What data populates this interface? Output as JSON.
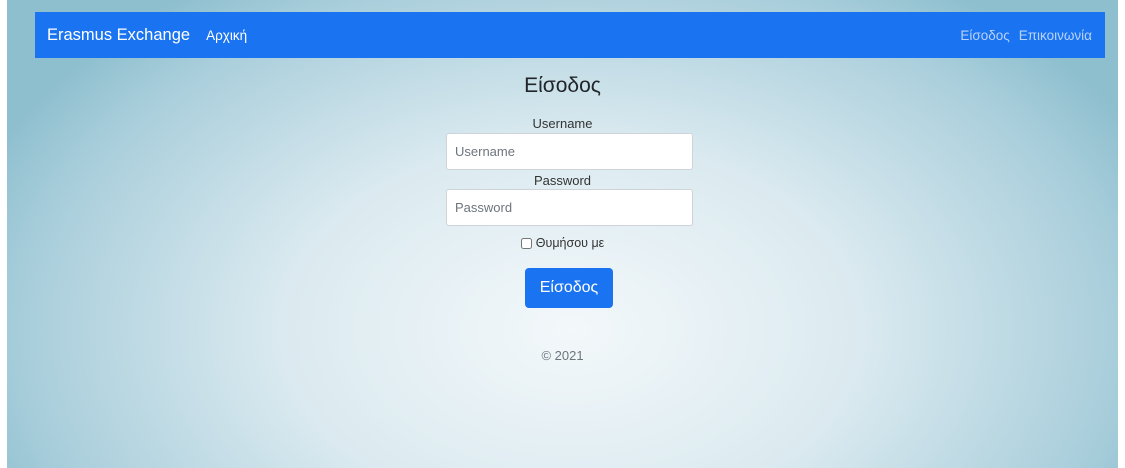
{
  "navbar": {
    "brand": "Erasmus Exchange",
    "home_link": "Αρχική",
    "login_link": "Είσοδος",
    "contact_link": "Επικοινωνία",
    "bg_color": "#1a73f0"
  },
  "form": {
    "title": "Είσοδος",
    "username_label": "Username",
    "username_placeholder": "Username",
    "username_value": "",
    "password_label": "Password",
    "password_placeholder": "Password",
    "password_value": "",
    "remember_label": "Θυμήσου με",
    "remember_checked": false,
    "submit_label": "Είσοδος"
  },
  "footer": {
    "copyright": "© 2021"
  }
}
